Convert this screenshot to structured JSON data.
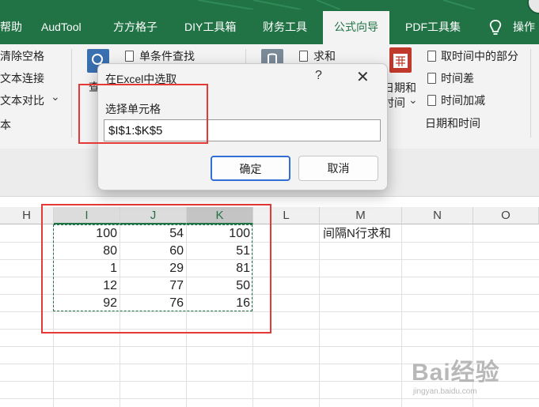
{
  "tabs": [
    {
      "label": "帮助"
    },
    {
      "label": "AudTool"
    },
    {
      "label": "方方格子"
    },
    {
      "label": "DIY工具箱"
    },
    {
      "label": "财务工具"
    },
    {
      "label": "公式向导",
      "active": true
    },
    {
      "label": "PDF工具集"
    },
    {
      "label": "操作"
    }
  ],
  "ribbon": {
    "col1": [
      "清除空格",
      "文本连接",
      "文本对比",
      "本"
    ],
    "col1_chevron": "⌄",
    "group2_big_label": "查",
    "group2_item": "单条件查找",
    "group3_item": "求和",
    "group4_big_label_1": "日期和",
    "group4_big_label_2": "时间",
    "group4_big_chevron": "⌄",
    "group4_items": [
      "取时间中的部分",
      "时间差",
      "时间加减"
    ],
    "group4_name": "日期和时间"
  },
  "dialog": {
    "title": "在Excel中选取",
    "help": "?",
    "close": "✕",
    "label": "选择单元格",
    "value": "$I$1:$K$5",
    "ok": "确定",
    "cancel": "取消"
  },
  "columns": [
    "H",
    "I",
    "J",
    "K",
    "L",
    "M",
    "N",
    "O"
  ],
  "rows": [
    {
      "I": "100",
      "J": "54",
      "K": "100"
    },
    {
      "I": "80",
      "J": "60",
      "K": "51"
    },
    {
      "I": "1",
      "J": "29",
      "K": "81"
    },
    {
      "I": "12",
      "J": "77",
      "K": "50"
    },
    {
      "I": "92",
      "J": "76",
      "K": "16"
    }
  ],
  "m1_text": "间隔N行求和",
  "watermark": {
    "text": "Bai经验",
    "sub": "jingyan.baidu.com"
  },
  "colors": {
    "excel_green": "#217346",
    "highlight_red": "#e53935",
    "focus_blue": "#2f6fd6"
  }
}
